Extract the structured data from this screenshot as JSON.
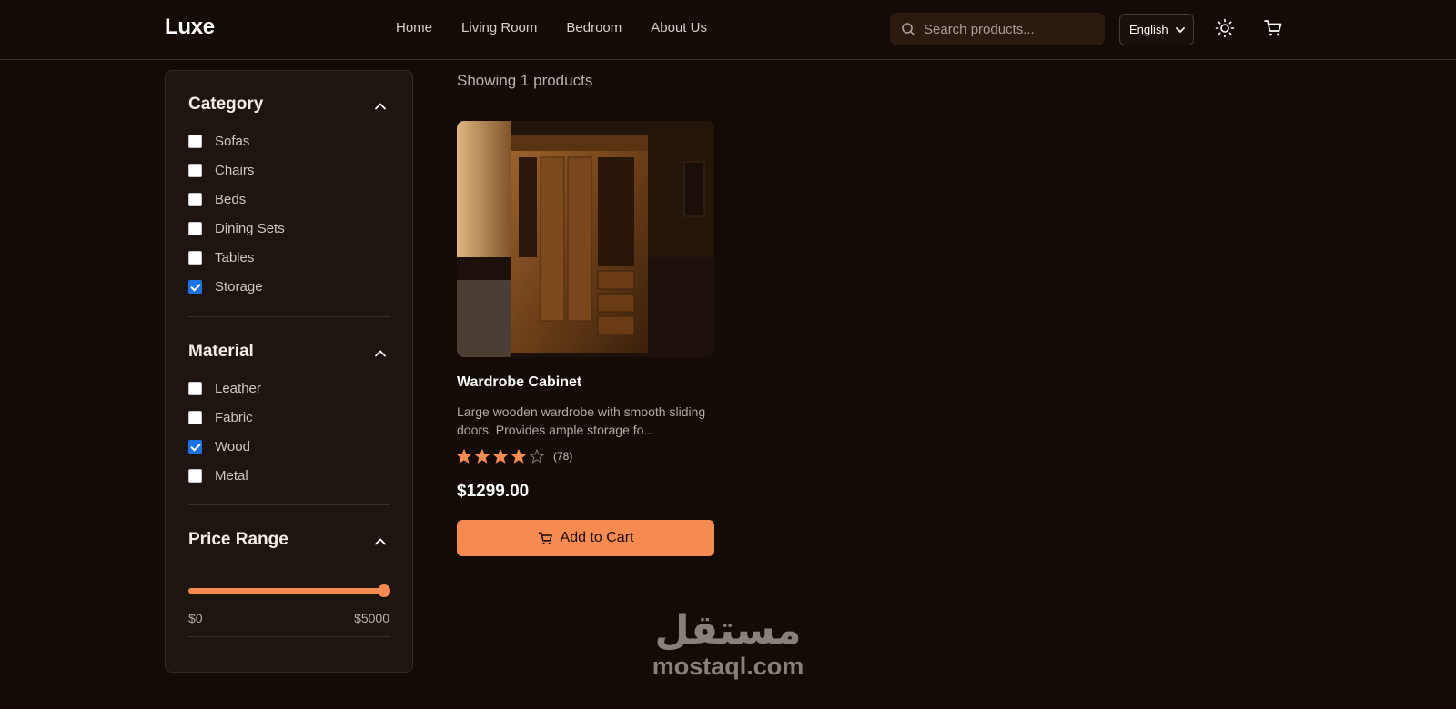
{
  "header": {
    "logo": "Luxe",
    "nav": [
      "Home",
      "Living Room",
      "Bedroom",
      "About Us"
    ],
    "search_placeholder": "Search products...",
    "language": "English"
  },
  "filters": {
    "category": {
      "title": "Category",
      "options": [
        {
          "label": "Sofas",
          "checked": false
        },
        {
          "label": "Chairs",
          "checked": false
        },
        {
          "label": "Beds",
          "checked": false
        },
        {
          "label": "Dining Sets",
          "checked": false
        },
        {
          "label": "Tables",
          "checked": false
        },
        {
          "label": "Storage",
          "checked": true
        }
      ]
    },
    "material": {
      "title": "Material",
      "options": [
        {
          "label": "Leather",
          "checked": false
        },
        {
          "label": "Fabric",
          "checked": false
        },
        {
          "label": "Wood",
          "checked": true
        },
        {
          "label": "Metal",
          "checked": false
        }
      ]
    },
    "price": {
      "title": "Price Range",
      "min_label": "$0",
      "max_label": "$5000",
      "selected_fraction": 1.0
    }
  },
  "results": {
    "showing": "Showing 1 products"
  },
  "product": {
    "name": "Wardrobe Cabinet",
    "description": "Large wooden wardrobe with smooth sliding doors. Provides ample storage fo...",
    "rating": 4,
    "rating_max": 5,
    "reviews": "(78)",
    "price": "$1299.00",
    "add_to_cart": "Add to Cart"
  },
  "watermark": {
    "arabic": "مستقل",
    "latin": "mostaql.com"
  },
  "colors": {
    "accent": "#f58b50",
    "background": "#140b06",
    "panel": "#1e1510",
    "checkbox_checked": "#1a73e8"
  }
}
